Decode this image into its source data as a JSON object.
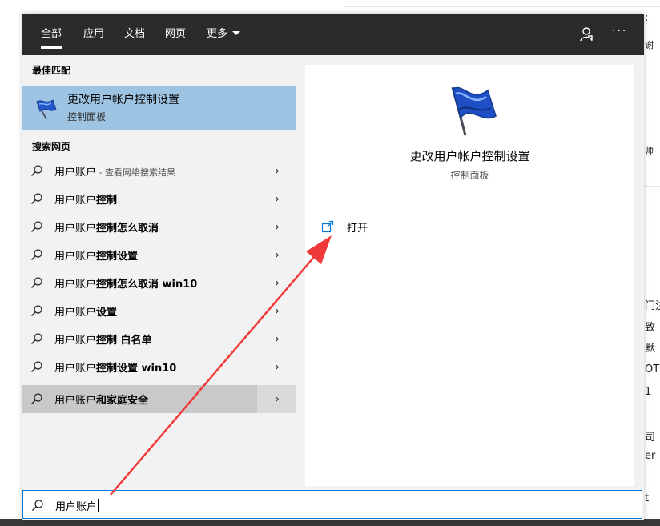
{
  "background": {
    "fragments": [
      ":",
      "谢",
      "帅",
      "门注",
      "致",
      "默",
      "OT",
      "1",
      "司",
      "er",
      "t"
    ]
  },
  "tabs": [
    {
      "label": "全部",
      "active": true
    },
    {
      "label": "应用"
    },
    {
      "label": "文档"
    },
    {
      "label": "网页"
    },
    {
      "label": "更多"
    }
  ],
  "toolbar": {
    "feedback_icon": "feedback-person-icon",
    "more_label": "···"
  },
  "best_match": {
    "header": "最佳匹配",
    "title": "更改用户帐户控制设置",
    "subtitle": "控制面板",
    "icon": "uac-flag-icon"
  },
  "web": {
    "header": "搜索网页",
    "items": [
      {
        "prefix": "用户账户",
        "bold": "",
        "sub": " - 查看网络搜索结果"
      },
      {
        "prefix": "用户账户",
        "bold": "控制",
        "sub": ""
      },
      {
        "prefix": "用户账户",
        "bold": "控制怎么取消",
        "sub": ""
      },
      {
        "prefix": "用户账户",
        "bold": "控制设置",
        "sub": ""
      },
      {
        "prefix": "用户账户",
        "bold": "控制怎么取消 win10",
        "sub": ""
      },
      {
        "prefix": "用户账户",
        "bold": "设置",
        "sub": ""
      },
      {
        "prefix": "用户账户",
        "bold": "控制 白名单",
        "sub": ""
      },
      {
        "prefix": "用户账户",
        "bold": "控制设置 win10",
        "sub": ""
      },
      {
        "prefix": "用户账户",
        "bold": "和家庭安全",
        "sub": ""
      }
    ],
    "chevron": "›"
  },
  "preview": {
    "title": "更改用户帐户控制设置",
    "subtitle": "控制面板",
    "action_label": "打开",
    "action_icon": "open-external-icon"
  },
  "search": {
    "value": "用户账户",
    "icon": "search-icon"
  },
  "colors": {
    "accent": "#0078d7",
    "selected": "#9ec4e4",
    "hover": "#c9c9c9",
    "annotation": "#f03a3a"
  }
}
